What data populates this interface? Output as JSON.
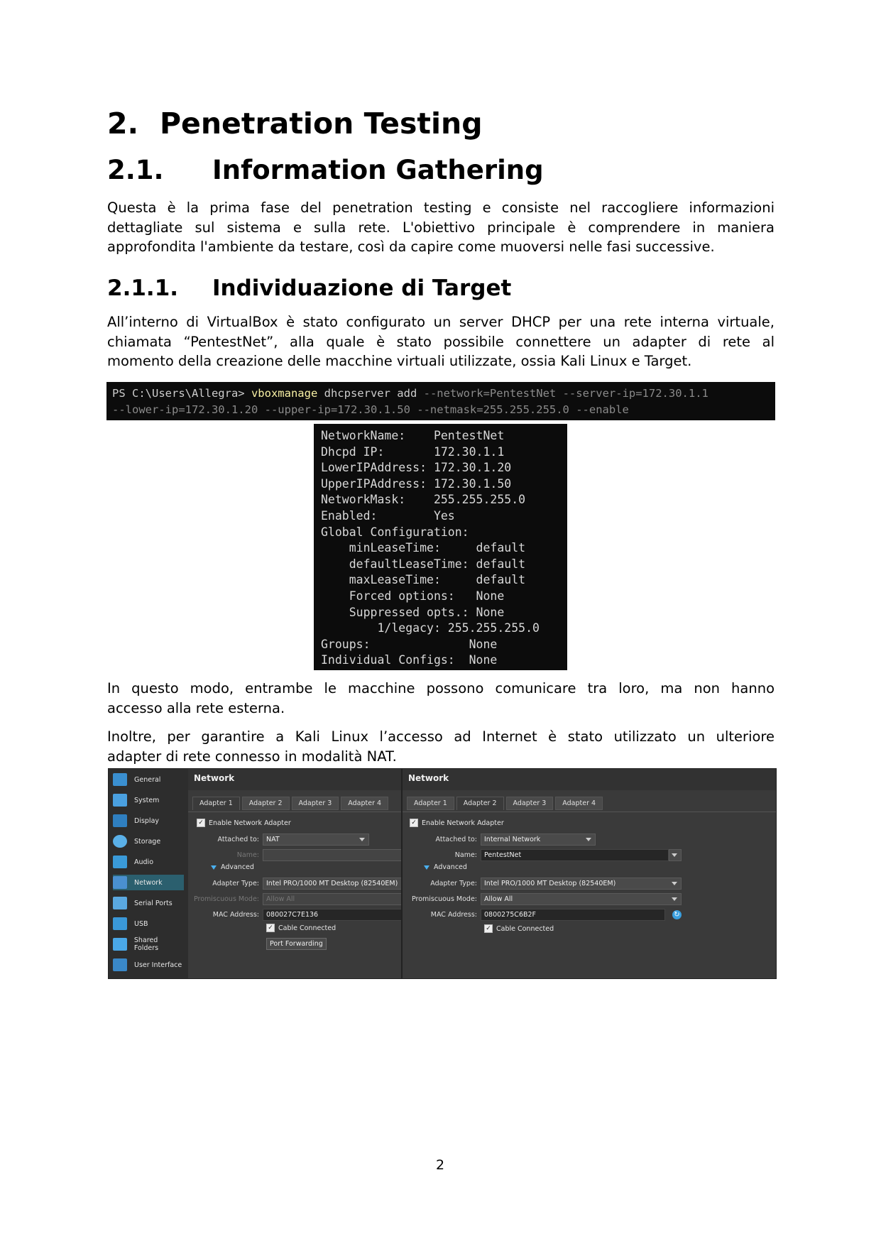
{
  "headings": {
    "h1": {
      "num": "2.",
      "text": "Penetration Testing"
    },
    "h2": {
      "num": "2.1.",
      "text": "Information Gathering"
    },
    "h3": {
      "num": "2.1.1.",
      "text": "Individuazione di Target"
    }
  },
  "paragraphs": {
    "p1": [
      "Questa è la prima fase del penetration testing e consiste nel raccogliere informazioni dettagliate sul sistema e sulla rete. L'obiettivo principale è comprendere in maniera",
      "approfondita l'ambiente da testare, così da capire come muoversi nelle fasi successive."
    ],
    "p2": [
      "All’interno di VirtualBox è stato configurato un server DHCP per una rete interna virtuale, chiamata “PentestNet”, alla quale è stato possibile connettere un adapter di rete al",
      "momento della creazione delle macchine virtuali utilizzate, ossia Kali Linux e Target."
    ],
    "p3": [
      "In questo modo, entrambe le macchine possono comunicare tra loro, ma non hanno",
      "accesso alla rete esterna."
    ],
    "p4": [
      "Inoltre, per garantire a Kali Linux l’accesso ad Internet è stato utilizzato un ulteriore",
      "adapter di rete connesso in modalità NAT."
    ]
  },
  "terminal1": {
    "prompt": "PS C:\\Users\\Allegra> ",
    "command": "vboxmanage",
    "args1": " dhcpserver add ",
    "opts1": "--network=PentestNet --server-ip=172.30.1.1",
    "opts2": "--lower-ip=172.30.1.20 --upper-ip=172.30.1.50 --netmask=255.255.255.0 --enable"
  },
  "terminal2": {
    "lines": [
      "NetworkName:    PentestNet",
      "Dhcpd IP:       172.30.1.1",
      "LowerIPAddress: 172.30.1.20",
      "UpperIPAddress: 172.30.1.50",
      "NetworkMask:    255.255.255.0",
      "Enabled:        Yes",
      "Global Configuration:",
      "    minLeaseTime:     default",
      "    defaultLeaseTime: default",
      "    maxLeaseTime:     default",
      "    Forced options:   None",
      "    Suppressed opts.: None",
      "        1/legacy: 255.255.255.0",
      "Groups:              None",
      "Individual Configs:  None"
    ]
  },
  "vbox": {
    "sidebar": [
      {
        "label": "General",
        "color": "#3a8fd0"
      },
      {
        "label": "System",
        "color": "#4aa0e0"
      },
      {
        "label": "Display",
        "color": "#2f7fc0"
      },
      {
        "label": "Storage",
        "color": "#5ab0e8"
      },
      {
        "label": "Audio",
        "color": "#3a9ad8"
      },
      {
        "label": "Network",
        "color": "#4a90d0"
      },
      {
        "label": "Serial Ports",
        "color": "#5aa8e0"
      },
      {
        "label": "USB",
        "color": "#3a98d8"
      },
      {
        "label": "Shared Folders",
        "color": "#4aa8e8"
      },
      {
        "label": "User Interface",
        "color": "#3a88c8"
      }
    ],
    "left": {
      "title": "Network",
      "tabs": [
        "Adapter 1",
        "Adapter 2",
        "Adapter 3",
        "Adapter 4"
      ],
      "enable": "Enable Network Adapter",
      "attached_label": "Attached to:",
      "attached_value": "NAT",
      "name_label": "Name:",
      "advanced": "Advanced",
      "adapter_type_label": "Adapter Type:",
      "adapter_type_value": "Intel PRO/1000 MT Desktop (82540EM)",
      "promisc_label": "Promiscuous Mode:",
      "promisc_value": "Allow All",
      "mac_label": "MAC Address:",
      "mac_value": "080027C7E136",
      "cable": "Cable Connected",
      "port_forwarding": "Port Forwarding"
    },
    "right": {
      "title": "Network",
      "tabs": [
        "Adapter 1",
        "Adapter 2",
        "Adapter 3",
        "Adapter 4"
      ],
      "enable": "Enable Network Adapter",
      "attached_label": "Attached to:",
      "attached_value": "Internal Network",
      "name_label": "Name:",
      "name_value": "PentestNet",
      "advanced": "Advanced",
      "adapter_type_label": "Adapter Type:",
      "adapter_type_value": "Intel PRO/1000 MT Desktop (82540EM)",
      "promisc_label": "Promiscuous Mode:",
      "promisc_value": "Allow All",
      "mac_label": "MAC Address:",
      "mac_value": "0800275C6B2F",
      "cable": "Cable Connected"
    }
  },
  "page_number": "2"
}
